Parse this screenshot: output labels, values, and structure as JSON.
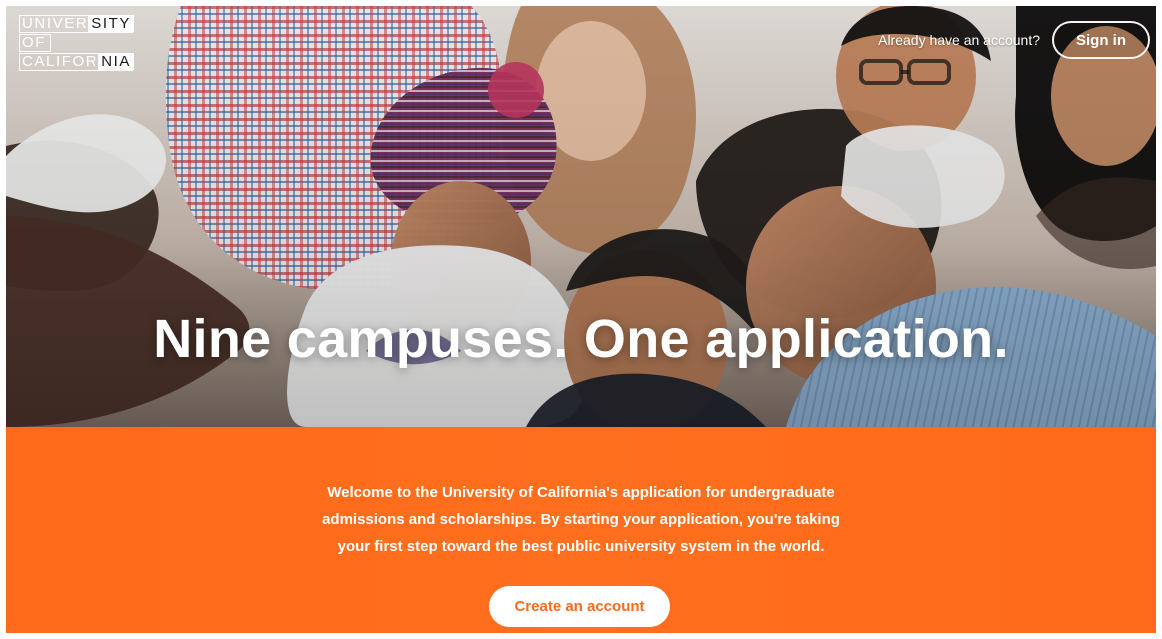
{
  "logo": {
    "line1_prefix": "UNIVER",
    "line1_suffix": "SITY",
    "line2": "OF",
    "line3_prefix": "CALIFOR",
    "line3_suffix": "NIA"
  },
  "header": {
    "already_text": "Already have an account?",
    "signin_label": "Sign in"
  },
  "hero": {
    "headline": "Nine campuses. One application."
  },
  "intro": {
    "lines": [
      "Welcome to the University of California's application for undergraduate",
      "admissions and scholarships. By starting your application, you're taking",
      "your first step toward the best public university system in the world."
    ]
  },
  "cta": {
    "create_account_label": "Create an account"
  },
  "colors": {
    "brand_orange": "#ff6a1a",
    "white": "#ffffff"
  }
}
